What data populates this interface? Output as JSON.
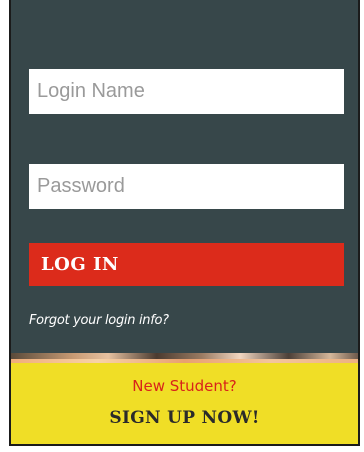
{
  "login": {
    "login_name_placeholder": "Login Name",
    "password_placeholder": "Password",
    "login_button_label": "LOG IN",
    "forgot_link_text": "Forgot your login info?"
  },
  "signup": {
    "new_student_text": "New Student?",
    "signup_button_label": "SIGN UP NOW!"
  },
  "colors": {
    "panel_background": "#37474a",
    "login_button": "#dc2b1b",
    "signup_background": "#f0de26",
    "new_student_text": "#d8231a"
  }
}
